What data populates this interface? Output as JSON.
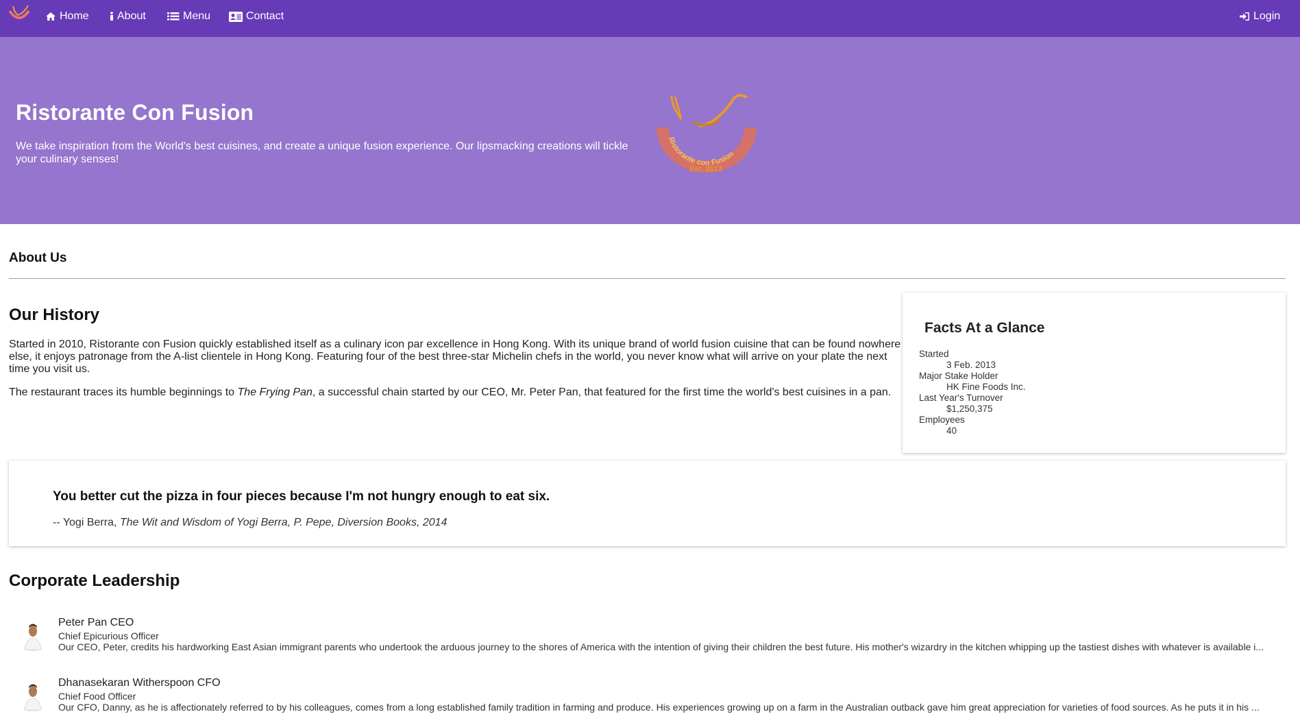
{
  "nav": {
    "items": [
      {
        "label": "Home",
        "icon": "home-icon"
      },
      {
        "label": "About",
        "icon": "info-icon"
      },
      {
        "label": "Menu",
        "icon": "list-icon"
      },
      {
        "label": "Contact",
        "icon": "address-card-icon"
      }
    ],
    "login_label": "Login",
    "login_icon": "sign-in-icon"
  },
  "jumbotron": {
    "title": "Ristorante Con Fusion",
    "text": "We take inspiration from the World's best cuisines, and create a unique fusion experience. Our lipsmacking creations will tickle your culinary senses!",
    "logo_text": "Ristorante con Fusion",
    "logo_est": "Est. 2013"
  },
  "about": {
    "heading": "About Us",
    "history_heading": "Our History",
    "history_p1": "Started in 2010, Ristorante con Fusion quickly established itself as a culinary icon par excellence in Hong Kong. With its unique brand of world fusion cuisine that can be found nowhere else, it enjoys patronage from the A-list clientele in Hong Kong. Featuring four of the best three-star Michelin chefs in the world, you never know what will arrive on your plate the next time you visit us.",
    "history_p2_before": "The restaurant traces its humble beginnings to ",
    "history_p2_em": "The Frying Pan",
    "history_p2_after": ", a successful chain started by our CEO, Mr. Peter Pan, that featured for the first time the world's best cuisines in a pan."
  },
  "facts": {
    "title": "Facts At a Glance",
    "items": [
      {
        "term": "Started",
        "value": "3 Feb. 2013"
      },
      {
        "term": "Major Stake Holder",
        "value": "HK Fine Foods Inc."
      },
      {
        "term": "Last Year's Turnover",
        "value": "$1,250,375"
      },
      {
        "term": "Employees",
        "value": "40"
      }
    ]
  },
  "quote": {
    "text": "You better cut the pizza in four pieces because I'm not hungry enough to eat six.",
    "author": "-- Yogi Berra, ",
    "source": "The Wit and Wisdom of Yogi Berra, P. Pepe, Diversion Books, 2014"
  },
  "leadership": {
    "heading": "Corporate Leadership",
    "leaders": [
      {
        "name": "Peter Pan CEO",
        "role": "Chief Epicurious Officer",
        "description": "Our CEO, Peter, credits his hardworking East Asian immigrant parents who undertook the arduous journey to the shores of America with the intention of giving their children the best future. His mother's wizardry in the kitchen whipping up the tastiest dishes with whatever is available i..."
      },
      {
        "name": "Dhanasekaran Witherspoon CFO",
        "role": "Chief Food Officer",
        "description": "Our CFO, Danny, as he is affectionately referred to by his colleagues, comes from a long established family tradition in farming and produce. His experiences growing up on a farm in the Australian outback gave him great appreciation for varieties of food sources. As he puts it in his ..."
      }
    ]
  },
  "colors": {
    "navbar": "#673ab7",
    "jumbotron": "#9575cd"
  }
}
